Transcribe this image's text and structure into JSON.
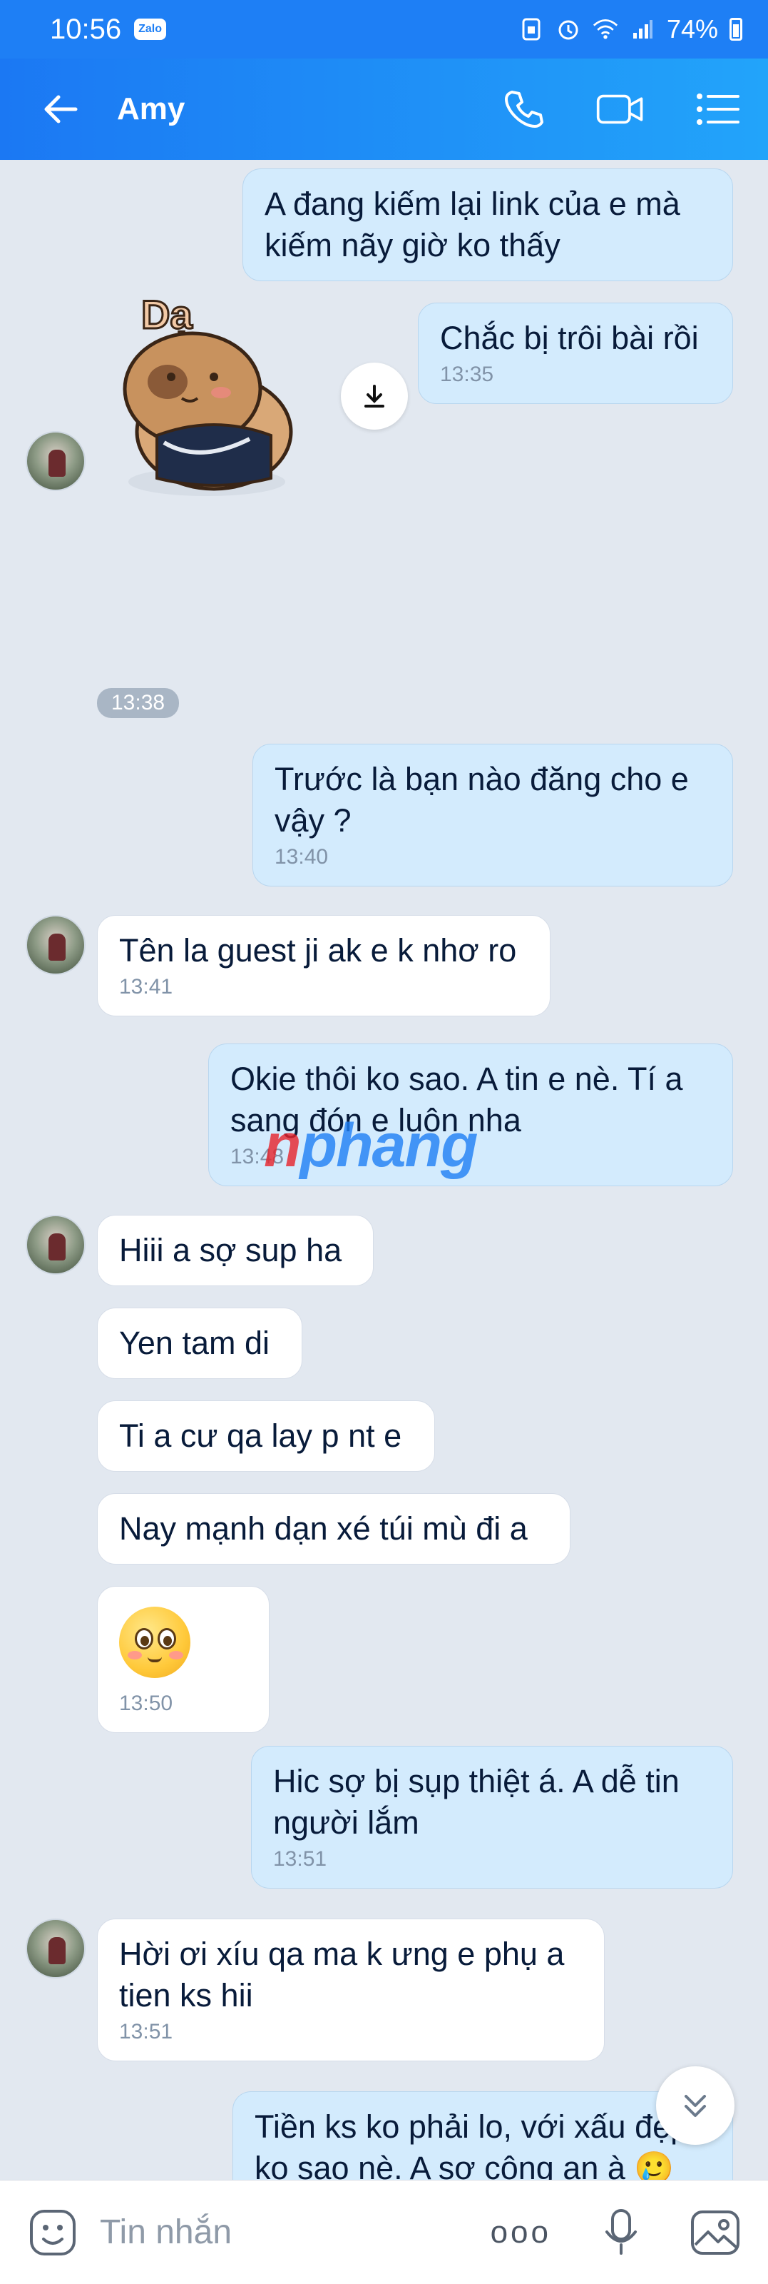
{
  "status_bar": {
    "time": "10:56",
    "app_badge": "Zalo",
    "battery": "74%"
  },
  "header": {
    "contact_name": "Amy",
    "icons": [
      "back-arrow-icon",
      "phone-icon",
      "video-call-icon",
      "menu-list-icon"
    ]
  },
  "messages": [
    {
      "side": "out",
      "text": "A đang kiếm lại link của e mà kiếm nãy giờ ko thấy",
      "time": ""
    },
    {
      "side": "out",
      "text": "Chắc bị trôi bài rồi",
      "time": "13:35"
    },
    {
      "side": "in",
      "type": "sticker",
      "sticker_text": "Dạ",
      "time": "13:38"
    },
    {
      "side": "out",
      "text": "Trước là bạn nào đăng cho e vậy ?",
      "time": "13:40"
    },
    {
      "side": "in",
      "text": "Tên la guest ji ak e k nhơ ro",
      "time": "13:41"
    },
    {
      "side": "out",
      "text": "Okie thôi ko sao. A tin e nè. Tí a sang đón e luôn nha",
      "time": "13:48"
    },
    {
      "side": "in",
      "text": "Hiii a sợ sup ha",
      "time": ""
    },
    {
      "side": "in",
      "text": "Yen tam di",
      "time": ""
    },
    {
      "side": "in",
      "text": "Ti a cư qa lay p nt e",
      "time": ""
    },
    {
      "side": "in",
      "text": "Nay mạnh dạn xé túi mù đi a",
      "time": ""
    },
    {
      "side": "in",
      "type": "emoji",
      "time": "13:50"
    },
    {
      "side": "out",
      "text": "Hic sợ bị sụp thiệt á. A dễ tin người lắm",
      "time": "13:51"
    },
    {
      "side": "in",
      "text": "Hời ơi xíu qa ma k ưng e phụ a tien ks hii",
      "time": "13:51"
    },
    {
      "side": "out",
      "text": "Tiền ks ko phải lo, với xấu đẹp ko sao nè. A sợ công an à 🥲",
      "time": ""
    }
  ],
  "watermark": {
    "part1": "n",
    "part2": "phang"
  },
  "composer": {
    "placeholder": "Tin nhắn",
    "more": "ooo"
  },
  "colors": {
    "header": "#1e7ff5",
    "outgoing_bubble": "#d3ebfd",
    "incoming_bubble": "#ffffff",
    "background": "#e2e8f0"
  }
}
